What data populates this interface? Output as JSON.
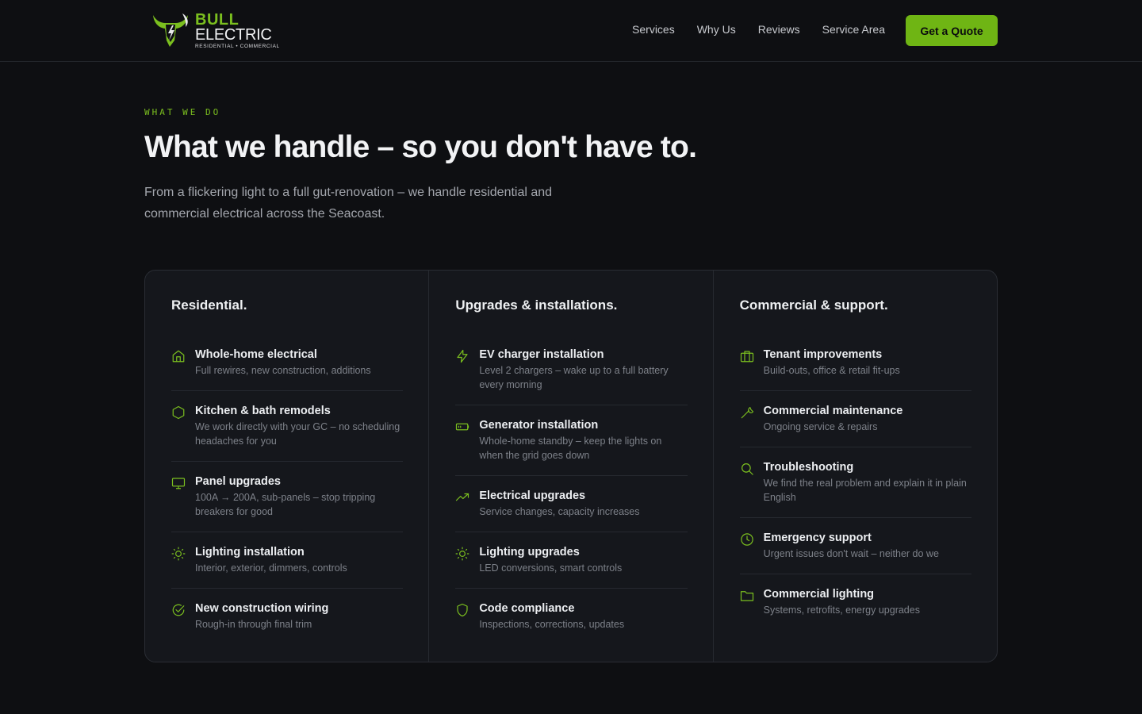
{
  "brand": {
    "word1": "BULL",
    "word2": "ELECTRIC",
    "tagline": "RESIDENTIAL • COMMERCIAL",
    "accent_color": "#7bbf1f"
  },
  "nav": {
    "items": [
      "Services",
      "Why Us",
      "Reviews",
      "Service Area"
    ],
    "cta_label": "Get a Quote"
  },
  "hero": {
    "eyebrow": "WHAT WE DO",
    "headline": "What we handle – so you don't have to.",
    "lede": "From a flickering light to a full gut-renovation – we handle residential and commercial electrical across the Seacoast."
  },
  "columns": [
    {
      "title": "Residential.",
      "items": [
        {
          "icon": "home-icon",
          "name": "Whole-home electrical",
          "desc": "Full rewires, new construction, additions"
        },
        {
          "icon": "hexagon-icon",
          "name": "Kitchen & bath remodels",
          "desc": "We work directly with your GC – no scheduling headaches for you"
        },
        {
          "icon": "monitor-icon",
          "name": "Panel upgrades",
          "desc": "100A → 200A, sub-panels – stop tripping breakers for good"
        },
        {
          "icon": "sun-icon",
          "name": "Lighting installation",
          "desc": "Interior, exterior, dimmers, controls"
        },
        {
          "icon": "check-circle-icon",
          "name": "New construction wiring",
          "desc": "Rough-in through final trim"
        }
      ]
    },
    {
      "title": "Upgrades & installations.",
      "items": [
        {
          "icon": "bolt-icon",
          "name": "EV charger installation",
          "desc": "Level 2 chargers – wake up to a full battery every morning"
        },
        {
          "icon": "battery-icon",
          "name": "Generator installation",
          "desc": "Whole-home standby – keep the lights on when the grid goes down"
        },
        {
          "icon": "trending-up-icon",
          "name": "Electrical upgrades",
          "desc": "Service changes, capacity increases"
        },
        {
          "icon": "sun-icon",
          "name": "Lighting upgrades",
          "desc": "LED conversions, smart controls"
        },
        {
          "icon": "shield-icon",
          "name": "Code compliance",
          "desc": "Inspections, corrections, updates"
        }
      ]
    },
    {
      "title": "Commercial & support.",
      "items": [
        {
          "icon": "briefcase-icon",
          "name": "Tenant improvements",
          "desc": "Build-outs, office & retail fit-ups"
        },
        {
          "icon": "wrench-icon",
          "name": "Commercial maintenance",
          "desc": "Ongoing service & repairs"
        },
        {
          "icon": "search-icon",
          "name": "Troubleshooting",
          "desc": "We find the real problem and explain it in plain English"
        },
        {
          "icon": "clock-icon",
          "name": "Emergency support",
          "desc": "Urgent issues don't wait – neither do we"
        },
        {
          "icon": "folder-icon",
          "name": "Commercial lighting",
          "desc": "Systems, retrofits, energy upgrades"
        }
      ]
    }
  ]
}
